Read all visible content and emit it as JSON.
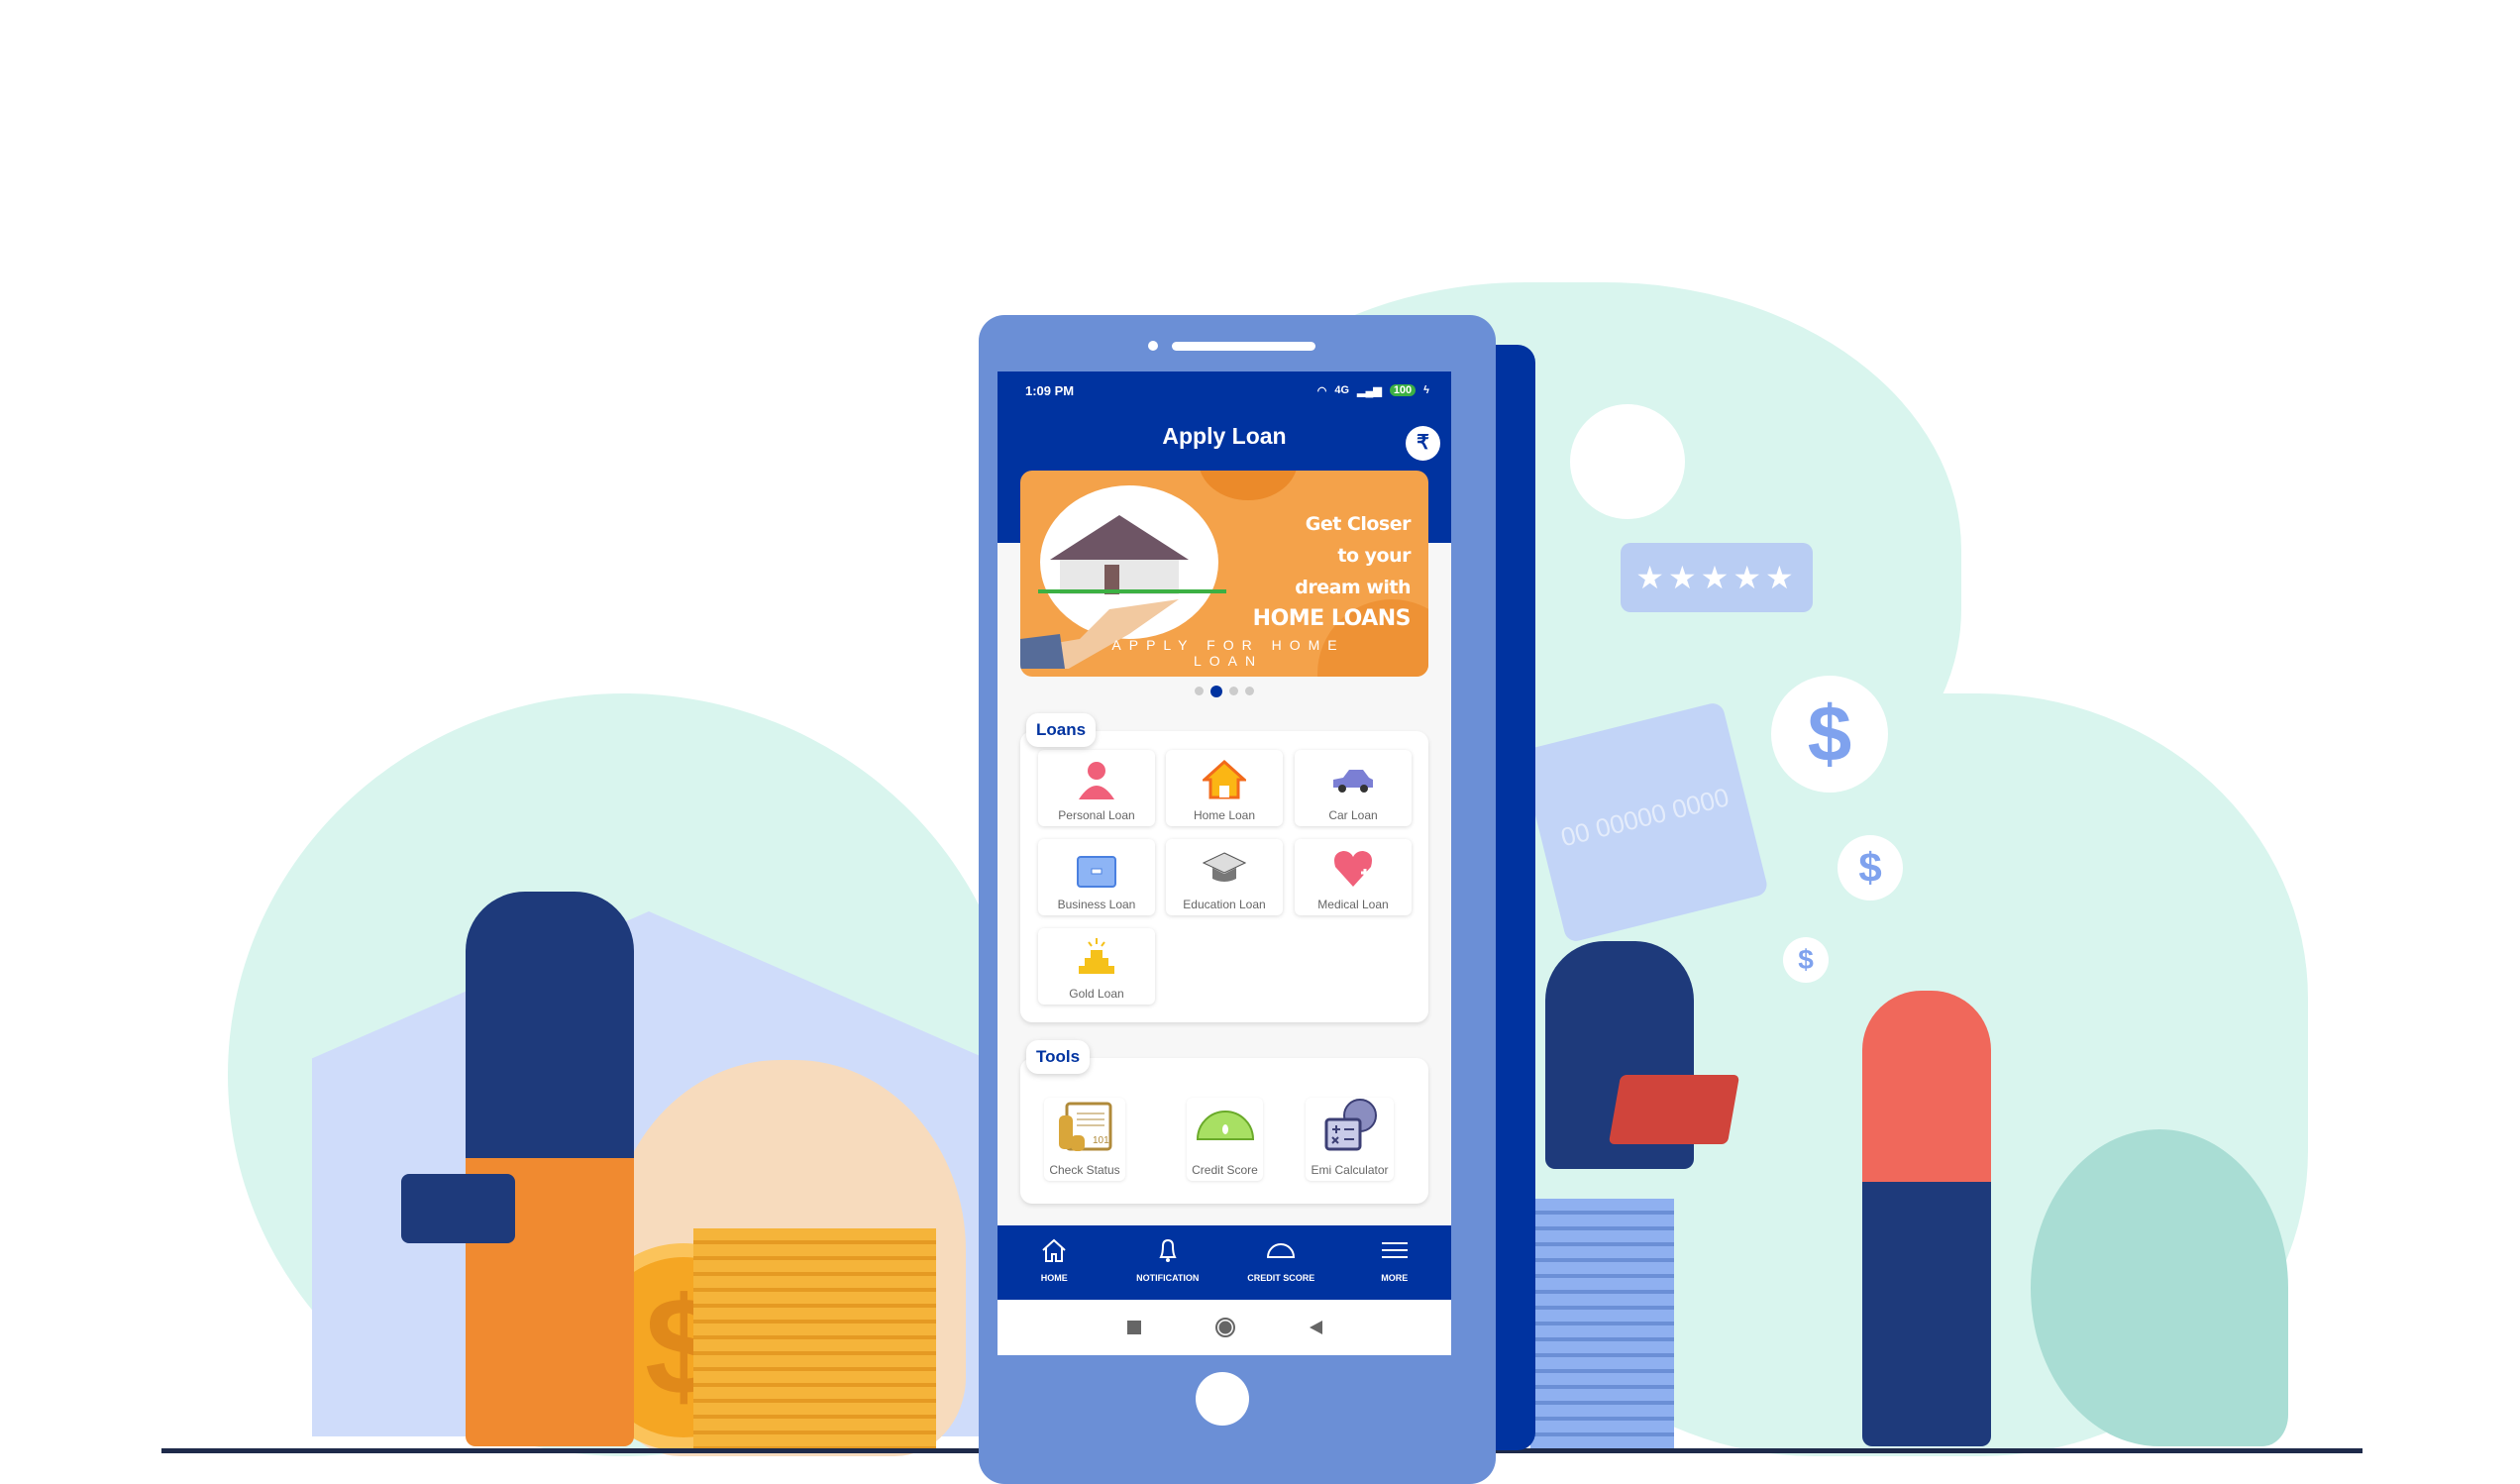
{
  "status_bar": {
    "time": "1:09 PM",
    "battery": "100",
    "network": "4G"
  },
  "header": {
    "title": "Apply Loan",
    "logo_glyph": "₹"
  },
  "banner": {
    "line1": "Get Closer",
    "line2": "to your",
    "line3": "dream with",
    "line4": "HOME LOANS",
    "footer": "APPLY FOR HOME LOAN",
    "slide_index": 2,
    "slide_count": 4
  },
  "loans": {
    "heading": "Loans",
    "items": [
      {
        "label": "Personal Loan",
        "icon": "person-icon"
      },
      {
        "label": "Home Loan",
        "icon": "house-icon"
      },
      {
        "label": "Car Loan",
        "icon": "car-icon"
      },
      {
        "label": "Business Loan",
        "icon": "briefcase-icon"
      },
      {
        "label": "Education Loan",
        "icon": "graduation-cap-icon"
      },
      {
        "label": "Medical Loan",
        "icon": "heart-plus-icon"
      },
      {
        "label": "Gold Loan",
        "icon": "gold-bars-icon"
      }
    ]
  },
  "tools": {
    "heading": "Tools",
    "items": [
      {
        "label": "Check Status",
        "icon": "coins-document-icon",
        "badge": "101"
      },
      {
        "label": "Credit Score",
        "icon": "speedometer-icon"
      },
      {
        "label": "Emi Calculator",
        "icon": "calculator-globe-icon"
      }
    ]
  },
  "bottom_nav": [
    {
      "label": "HOME",
      "icon": "home-icon"
    },
    {
      "label": "NOTIFICATION",
      "icon": "bell-icon"
    },
    {
      "label": "CREDIT SCORE",
      "icon": "gauge-icon"
    },
    {
      "label": "MORE",
      "icon": "menu-icon"
    }
  ],
  "decor": {
    "card_number": "00 00000 0000",
    "dollar": "$",
    "rating_stars": 5
  },
  "colors": {
    "primary": "#0033a0",
    "phone_body": "#6b8fd6",
    "banner": "#f4a24a",
    "mint": "#d9f5ee"
  }
}
